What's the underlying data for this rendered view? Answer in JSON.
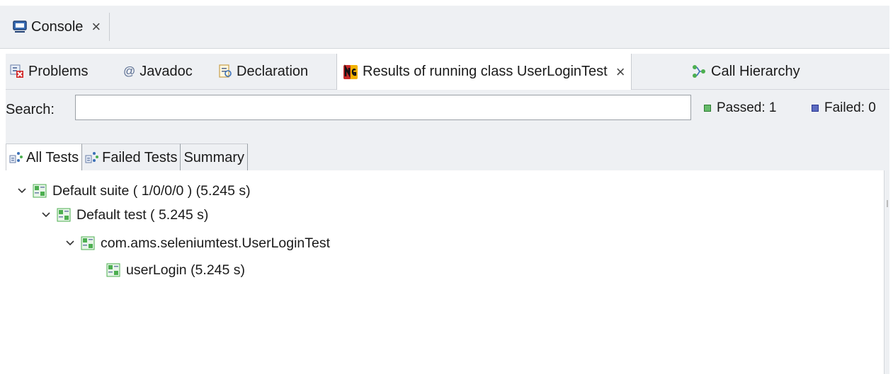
{
  "console_tab": {
    "label": "Console",
    "icon": "console-icon"
  },
  "views_tabs": [
    {
      "label": "Problems",
      "icon": "problems-icon"
    },
    {
      "label": "Javadoc",
      "icon": "javadoc-icon"
    },
    {
      "label": "Declaration",
      "icon": "declaration-icon"
    },
    {
      "label": "Results of running class UserLoginTest",
      "icon": "testng-icon",
      "active": true
    },
    {
      "label": "Call Hierarchy",
      "icon": "call-hierarchy-icon"
    }
  ],
  "search": {
    "label": "Search:",
    "value": "",
    "placeholder": ""
  },
  "stats": {
    "passed": "Passed: 1",
    "failed": "Failed: 0"
  },
  "subtabs": [
    {
      "label": "All Tests",
      "active": true
    },
    {
      "label": "Failed Tests"
    },
    {
      "label": "Summary"
    }
  ],
  "tree": [
    {
      "label": "Default suite ( 1/0/0/0 ) (5.245 s)",
      "expanded": true,
      "level": 0
    },
    {
      "label": "Default test ( 5.245 s)",
      "expanded": true,
      "level": 1
    },
    {
      "label": "com.ams.seleniumtest.UserLoginTest",
      "expanded": true,
      "level": 2
    },
    {
      "label": "userLogin  (5.245 s)",
      "level": 3
    }
  ],
  "colors": {
    "pass_green": "#4caf50",
    "panel_bg": "#eef0f3",
    "tab_border": "#c9ccd1"
  }
}
